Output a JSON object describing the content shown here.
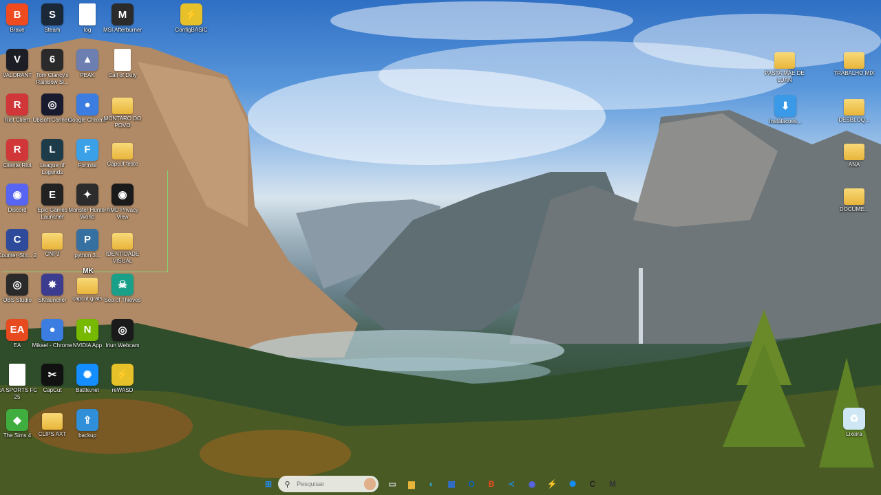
{
  "desktop_icons_left": [
    {
      "label": "Brave",
      "icon": "brave-icon",
      "color": "#f04a1f",
      "glyph": "B"
    },
    {
      "label": "Steam",
      "icon": "steam-icon",
      "color": "#1b2838",
      "glyph": "S"
    },
    {
      "label": "log",
      "icon": "file-icon",
      "color": "#ffffff",
      "glyph": ""
    },
    {
      "label": "MSI Afterburner",
      "icon": "msi-afterburner-icon",
      "color": "#2b2b2b",
      "glyph": "M"
    },
    {
      "label": "ConfigBASIC",
      "icon": "lightning-icon",
      "color": "#e7c12a",
      "glyph": "⚡"
    },
    {
      "label": "VALORANT",
      "icon": "valorant-icon",
      "color": "#1d1d25",
      "glyph": "V"
    },
    {
      "label": "Tom Clancy's Rainbow Si...",
      "icon": "rainbow-six-icon",
      "color": "#2a2a2a",
      "glyph": "6"
    },
    {
      "label": "PEAK",
      "icon": "peak-icon",
      "color": "#6c7fb0",
      "glyph": "▲"
    },
    {
      "label": "Call of Duty",
      "icon": "file-icon",
      "color": "#ffffff",
      "glyph": ""
    },
    {
      "label": "Riot Client",
      "icon": "riot-icon",
      "color": "#d13639",
      "glyph": "R"
    },
    {
      "label": "Ubisoft Connect",
      "icon": "ubisoft-icon",
      "color": "#1a1a2e",
      "glyph": "◎"
    },
    {
      "label": "Google Chrome",
      "icon": "chrome-icon",
      "color": "#3b7de0",
      "glyph": "●"
    },
    {
      "label": "MONTARO DO POVO",
      "icon": "folder-icon",
      "color": "#e8b53a",
      "glyph": ""
    },
    {
      "label": "Cliente Riot",
      "icon": "riot-icon",
      "color": "#d13639",
      "glyph": "R"
    },
    {
      "label": "League of Legends",
      "icon": "lol-icon",
      "color": "#1e3b4a",
      "glyph": "L"
    },
    {
      "label": "Fortnite",
      "icon": "fortnite-icon",
      "color": "#3aa0e8",
      "glyph": "F"
    },
    {
      "label": "Capcut teste",
      "icon": "folder-icon",
      "color": "#e8b53a",
      "glyph": ""
    },
    {
      "label": "Discord",
      "icon": "discord-icon",
      "color": "#5865f2",
      "glyph": "◉"
    },
    {
      "label": "Epic Games Launcher",
      "icon": "epic-icon",
      "color": "#222",
      "glyph": "E"
    },
    {
      "label": "Monster Hunter World",
      "icon": "mhw-icon",
      "color": "#2c2c2c",
      "glyph": "✦"
    },
    {
      "label": "AMD Privacy View",
      "icon": "amd-privacy-icon",
      "color": "#1a1a1a",
      "glyph": "◉"
    },
    {
      "label": "Counter-Stri... 2",
      "icon": "cs2-icon",
      "color": "#2e4a9a",
      "glyph": "C"
    },
    {
      "label": "CNPJ",
      "icon": "folder-icon",
      "color": "#e8b53a",
      "glyph": ""
    },
    {
      "label": "python 3...",
      "icon": "python-icon",
      "color": "#3670a0",
      "glyph": "P"
    },
    {
      "label": "IDENTIDADE VISUAL",
      "icon": "folder-icon",
      "color": "#e8b53a",
      "glyph": ""
    },
    {
      "label": "OBS Studio",
      "icon": "obs-icon",
      "color": "#2a2a2a",
      "glyph": "◎"
    },
    {
      "label": "SKlauncher",
      "icon": "sklauncher-icon",
      "color": "#3b3b8f",
      "glyph": "✸"
    },
    {
      "label": "capcut grats",
      "icon": "folder-icon",
      "color": "#e8b53a",
      "glyph": ""
    },
    {
      "label": "Sea of Thieves",
      "icon": "sea-of-thieves-icon",
      "color": "#1aa089",
      "glyph": "☠"
    },
    {
      "label": "EA",
      "icon": "ea-icon",
      "color": "#e84a1f",
      "glyph": "EA"
    },
    {
      "label": "Mikael - Chrome",
      "icon": "chrome-icon",
      "color": "#3b7de0",
      "glyph": "●"
    },
    {
      "label": "NVIDIA App",
      "icon": "nvidia-icon",
      "color": "#76b900",
      "glyph": "N"
    },
    {
      "label": "Iriun Webcam",
      "icon": "webcam-icon",
      "color": "#1a1a1a",
      "glyph": "◎"
    },
    {
      "label": "EA SPORTS FC 25",
      "icon": "file-icon",
      "color": "#ffffff",
      "glyph": ""
    },
    {
      "label": "CapCut",
      "icon": "capcut-icon",
      "color": "#111",
      "glyph": "✂"
    },
    {
      "label": "Battle.net",
      "icon": "battlenet-icon",
      "color": "#148eff",
      "glyph": "✺"
    },
    {
      "label": "reWASD",
      "icon": "lightning-icon",
      "color": "#e7c12a",
      "glyph": "⚡"
    },
    {
      "label": "The Sims 4",
      "icon": "sims-icon",
      "color": "#3fae3f",
      "glyph": "◆"
    },
    {
      "label": "CLIPS AXT",
      "icon": "folder-icon",
      "color": "#e8b53a",
      "glyph": ""
    },
    {
      "label": "backup",
      "icon": "backup-icon",
      "color": "#2f8fd8",
      "glyph": "⇪"
    }
  ],
  "desktop_icons_right": [
    {
      "label": "PASTA MÃE DE LUAN",
      "icon": "folder-icon",
      "color": "#e8b53a",
      "glyph": ""
    },
    {
      "label": "TRABALHO MIX",
      "icon": "folder-icon",
      "color": "#e8b53a",
      "glyph": ""
    },
    {
      "label": "Instalacoes...",
      "icon": "installer-icon",
      "color": "#3a9ae8",
      "glyph": "⬇"
    },
    {
      "label": "DESBLOQ...",
      "icon": "folder-icon",
      "color": "#e8b53a",
      "glyph": ""
    },
    {
      "label": "ANA",
      "icon": "folder-icon",
      "color": "#e8b53a",
      "glyph": ""
    },
    {
      "label": "DOCUME...",
      "icon": "folder-icon",
      "color": "#e8b53a",
      "glyph": ""
    },
    {
      "label": "Lixeira",
      "icon": "recycle-bin-icon",
      "color": "#cfe6f5",
      "glyph": "♻"
    }
  ],
  "taskbar": {
    "search_placeholder": "Pesquisar",
    "apps": [
      {
        "name": "start-button",
        "glyph": "⊞",
        "color": "#1f8bf0"
      },
      {
        "name": "task-view-icon",
        "glyph": "▭",
        "color": "#cccccc"
      },
      {
        "name": "file-explorer-icon",
        "glyph": "▆",
        "color": "#e8b53a"
      },
      {
        "name": "edge-icon",
        "glyph": "◐",
        "color": "#2da8d8"
      },
      {
        "name": "store-icon",
        "glyph": "▦",
        "color": "#2f6fd8"
      },
      {
        "name": "outlook-icon",
        "glyph": "O",
        "color": "#0a66c2"
      },
      {
        "name": "brave-icon",
        "glyph": "B",
        "color": "#f04a1f"
      },
      {
        "name": "vscode-icon",
        "glyph": "≺",
        "color": "#1f8ad2"
      },
      {
        "name": "discord-icon",
        "glyph": "◉",
        "color": "#5865f2"
      },
      {
        "name": "rewasd-icon",
        "glyph": "⚡",
        "color": "#e7c12a"
      },
      {
        "name": "battlenet-icon",
        "glyph": "✺",
        "color": "#148eff"
      },
      {
        "name": "call-of-duty-icon",
        "glyph": "C",
        "color": "#222"
      },
      {
        "name": "msi-afterburner-icon",
        "glyph": "M",
        "color": "#333"
      }
    ]
  },
  "mk_label": "MK"
}
